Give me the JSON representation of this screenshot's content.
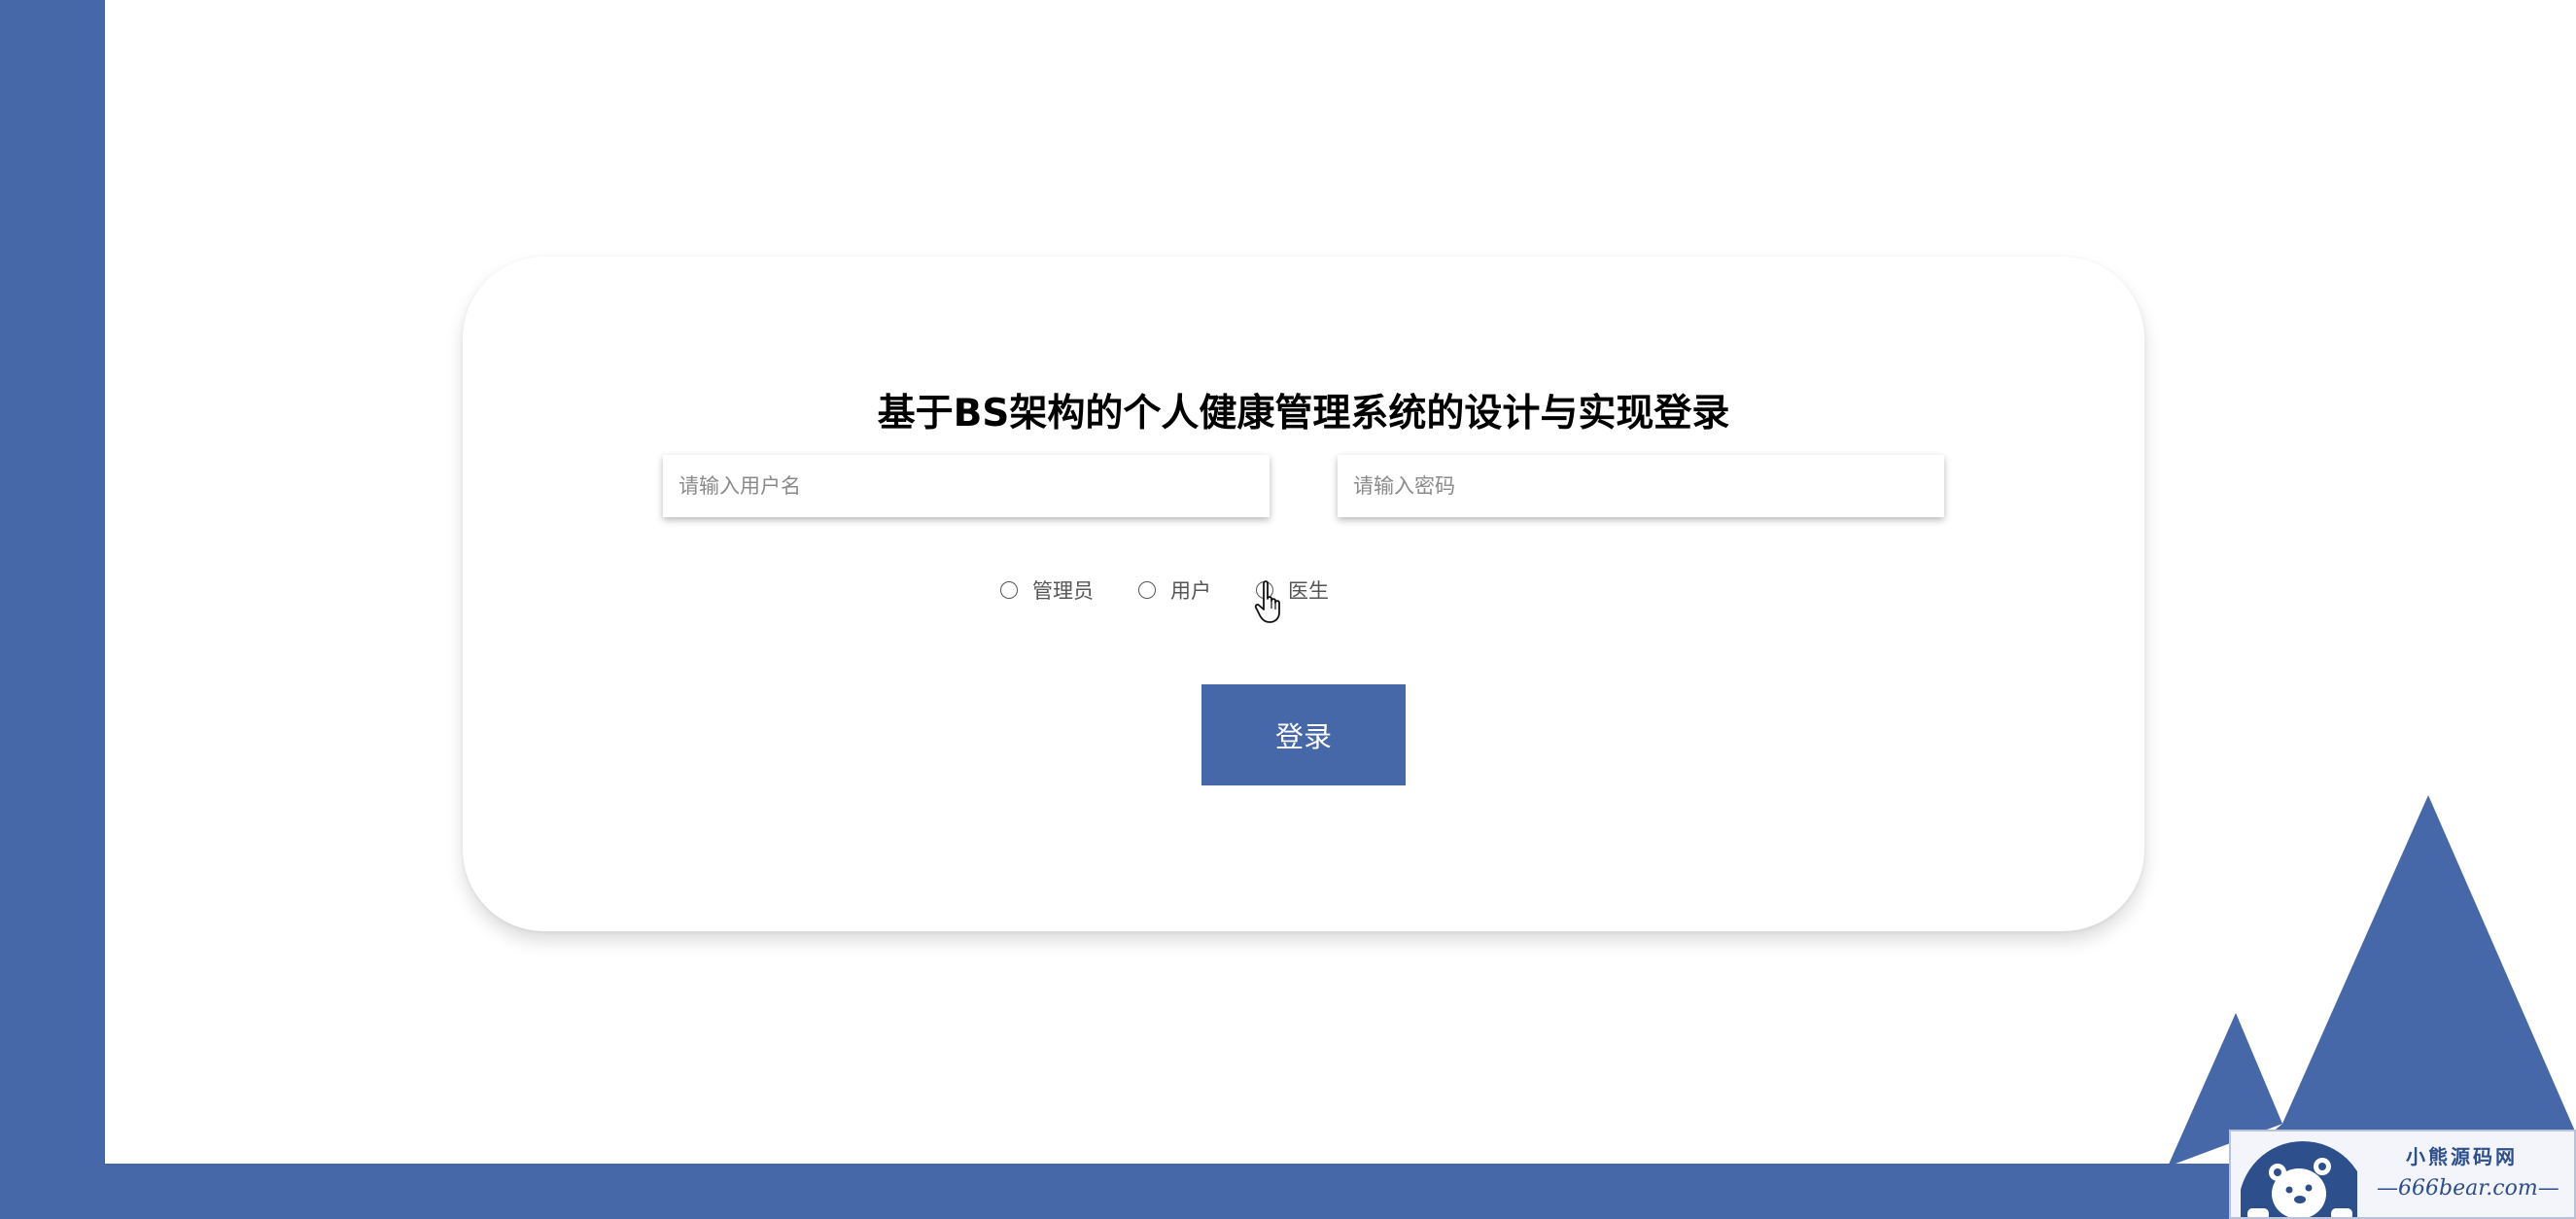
{
  "page": {
    "title": "基于BS架构的个人健康管理系统的设计与实现登录"
  },
  "form": {
    "username_placeholder": "请输入用户名",
    "password_placeholder": "请输入密码",
    "roles": [
      "管理员",
      "用户",
      "医生"
    ],
    "login_label": "登录"
  },
  "watermark": {
    "name": "小熊源码网",
    "url": "—666bear.com—"
  },
  "colors": {
    "accent": "#4667a8",
    "background": "#ffffff",
    "title_text": "#000000",
    "label_text": "#555555"
  },
  "icons": {
    "cursor": "hand-pointer-icon",
    "watermark_logo": "bear-logo-icon"
  }
}
